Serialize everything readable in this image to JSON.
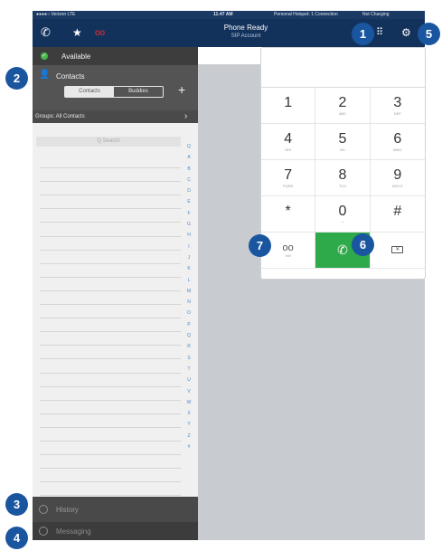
{
  "status_bar": {
    "carrier": "●●●●○ Verizon  LTE",
    "time": "11:47 AM",
    "hotspot": "Personal Hotspot: 1 Connection",
    "charging": "Not Charging"
  },
  "nav": {
    "title": "Phone Ready",
    "subtitle": "SIP Account",
    "icons": [
      "phone-icon",
      "star-icon",
      "voicemail-icon",
      "dialpad-icon",
      "gear-icon"
    ]
  },
  "presence": {
    "label": "Available",
    "color": "#44b84a"
  },
  "contacts": {
    "title": "Contacts",
    "segments": [
      "Contacts",
      "Buddies"
    ],
    "selected_segment": "Contacts",
    "groups_label": "Groups: All Contacts",
    "search_placeholder": "Q  Search",
    "alphabet": [
      "Q",
      "A",
      "B",
      "C",
      "D",
      "E",
      "F",
      "G",
      "H",
      "I",
      "J",
      "K",
      "L",
      "M",
      "N",
      "O",
      "P",
      "Q",
      "R",
      "S",
      "T",
      "U",
      "V",
      "W",
      "X",
      "Y",
      "Z",
      "#"
    ]
  },
  "bottom_tabs": {
    "history": "History",
    "messaging": "Messaging"
  },
  "dialpad": {
    "keys": [
      {
        "num": "1",
        "letters": ""
      },
      {
        "num": "2",
        "letters": "ABC"
      },
      {
        "num": "3",
        "letters": "DEF"
      },
      {
        "num": "4",
        "letters": "GHI"
      },
      {
        "num": "5",
        "letters": "JKL"
      },
      {
        "num": "6",
        "letters": "MNO"
      },
      {
        "num": "7",
        "letters": "PQRS"
      },
      {
        "num": "8",
        "letters": "TUV"
      },
      {
        "num": "9",
        "letters": "WXYZ"
      },
      {
        "num": "*",
        "letters": ""
      },
      {
        "num": "0",
        "letters": "+"
      },
      {
        "num": "#",
        "letters": ""
      }
    ],
    "vm_label": "VM",
    "call_color": "#2eaa4a"
  },
  "callouts": [
    "1",
    "2",
    "3",
    "4",
    "5",
    "6",
    "7"
  ],
  "colors": {
    "navbar": "#13325b",
    "callout": "#1a56a0",
    "accent": "#4f88c6"
  }
}
